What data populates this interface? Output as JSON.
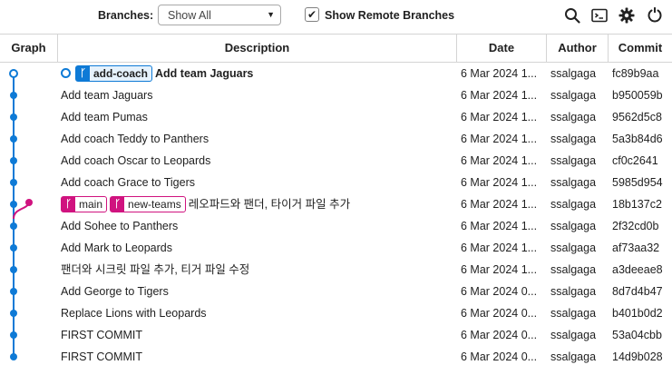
{
  "toolbar": {
    "branches_label": "Branches:",
    "branch_select_value": "Show All",
    "show_remote_label": "Show Remote Branches",
    "show_remote_checked": true,
    "icons": [
      "search-icon",
      "terminal-icon",
      "settings-gear-icon",
      "refresh-icon"
    ]
  },
  "columns": {
    "graph": "Graph",
    "description": "Description",
    "date": "Date",
    "author": "Author",
    "commit": "Commit"
  },
  "colors": {
    "branch_blue": "#0e7ad6",
    "branch_pink": "#d0137f"
  },
  "rows": [
    {
      "refs": [
        {
          "name": "add-coach",
          "color": "blue"
        }
      ],
      "head": true,
      "message": "Add team Jaguars",
      "date": "6 Mar 2024 1...",
      "author": "ssalgaga",
      "commit": "fc89b9aa"
    },
    {
      "refs": [],
      "message": "Add team Jaguars",
      "date": "6 Mar 2024 1...",
      "author": "ssalgaga",
      "commit": "b950059b"
    },
    {
      "refs": [],
      "message": "Add team Pumas",
      "date": "6 Mar 2024 1...",
      "author": "ssalgaga",
      "commit": "9562d5c8"
    },
    {
      "refs": [],
      "message": "Add coach Teddy to Panthers",
      "date": "6 Mar 2024 1...",
      "author": "ssalgaga",
      "commit": "5a3b84d6"
    },
    {
      "refs": [],
      "message": "Add coach Oscar to Leopards",
      "date": "6 Mar 2024 1...",
      "author": "ssalgaga",
      "commit": "cf0c2641"
    },
    {
      "refs": [],
      "message": "Add coach Grace to Tigers",
      "date": "6 Mar 2024 1...",
      "author": "ssalgaga",
      "commit": "5985d954"
    },
    {
      "refs": [
        {
          "name": "main",
          "color": "pink"
        },
        {
          "name": "new-teams",
          "color": "pink"
        }
      ],
      "message": "레오파드와 팬더, 타이거 파일 추가",
      "date": "6 Mar 2024 1...",
      "author": "ssalgaga",
      "commit": "18b137c2"
    },
    {
      "refs": [],
      "message": "Add Sohee to Panthers",
      "date": "6 Mar 2024 1...",
      "author": "ssalgaga",
      "commit": "2f32cd0b"
    },
    {
      "refs": [],
      "message": "Add Mark to Leopards",
      "date": "6 Mar 2024 1...",
      "author": "ssalgaga",
      "commit": "af73aa32"
    },
    {
      "refs": [],
      "message": "팬더와 시크릿 파일 추가, 티거 파일 수정",
      "date": "6 Mar 2024 1...",
      "author": "ssalgaga",
      "commit": "a3deeae8"
    },
    {
      "refs": [],
      "message": "Add George to Tigers",
      "date": "6 Mar 2024 0...",
      "author": "ssalgaga",
      "commit": "8d7d4b47"
    },
    {
      "refs": [],
      "message": "Replace Lions with Leopards",
      "date": "6 Mar 2024 0...",
      "author": "ssalgaga",
      "commit": "b401b0d2"
    },
    {
      "refs": [],
      "message": "FIRST COMMIT",
      "date": "6 Mar 2024 0...",
      "author": "ssalgaga",
      "commit": "53a04cbb"
    },
    {
      "refs": [],
      "message": "FIRST COMMIT",
      "date": "6 Mar 2024 0...",
      "author": "ssalgaga",
      "commit": "14d9b028"
    }
  ]
}
